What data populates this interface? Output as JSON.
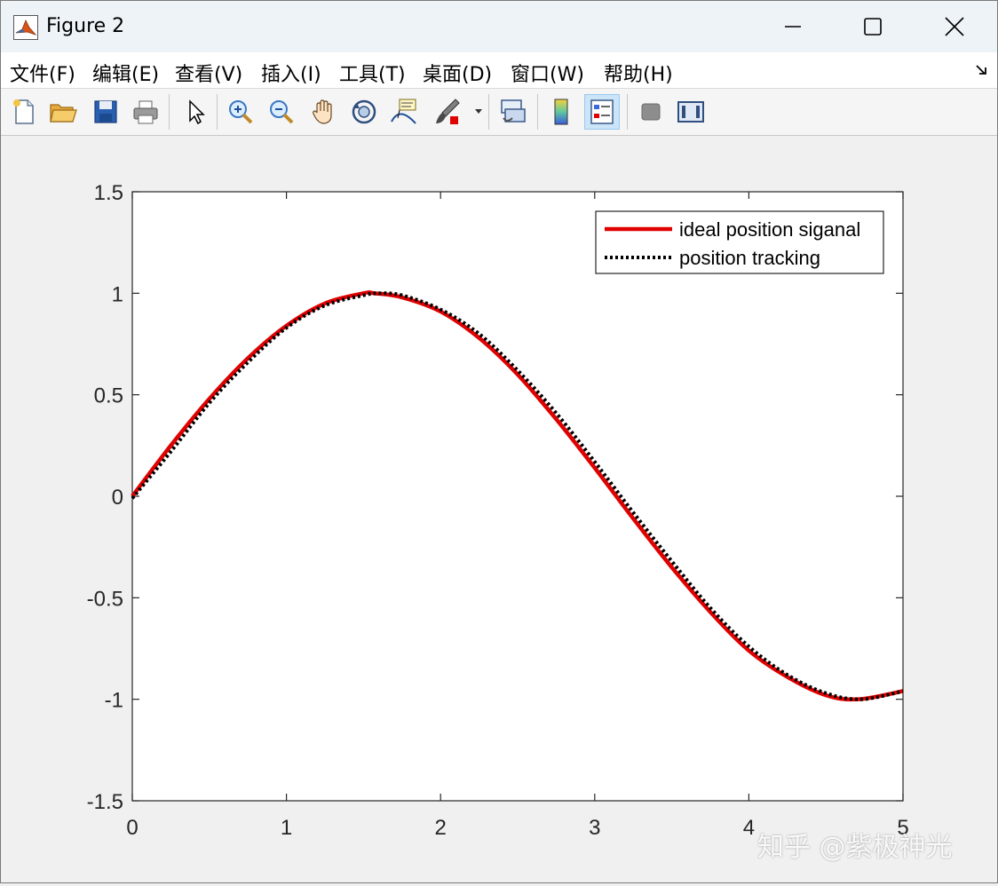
{
  "window": {
    "title": "Figure 2",
    "app_icon": "matlab-icon",
    "controls": [
      "minimize-icon",
      "maximize-icon",
      "close-icon"
    ]
  },
  "menubar": {
    "items": [
      {
        "label": "文件(F)"
      },
      {
        "label": "编辑(E)"
      },
      {
        "label": "查看(V)"
      },
      {
        "label": "插入(I)"
      },
      {
        "label": "工具(T)"
      },
      {
        "label": "桌面(D)"
      },
      {
        "label": "窗口(W)"
      },
      {
        "label": "帮助(H)"
      }
    ],
    "dock_icon": "dock-arrow-icon"
  },
  "toolbar": {
    "buttons": [
      {
        "icon": "new-figure-icon"
      },
      {
        "icon": "open-file-icon"
      },
      {
        "icon": "save-icon"
      },
      {
        "icon": "print-icon"
      },
      {
        "icon": "edit-plot-arrow-icon"
      },
      {
        "icon": "zoom-in-icon"
      },
      {
        "icon": "zoom-out-icon"
      },
      {
        "icon": "pan-hand-icon"
      },
      {
        "icon": "rotate-3d-icon"
      },
      {
        "icon": "data-cursor-icon"
      },
      {
        "icon": "brush-icon"
      },
      {
        "icon": "link-plot-icon"
      },
      {
        "icon": "insert-colorbar-icon"
      },
      {
        "icon": "insert-legend-icon",
        "active": true
      },
      {
        "icon": "hide-plot-tools-icon"
      },
      {
        "icon": "show-plot-tools-icon"
      }
    ]
  },
  "chart_data": {
    "type": "line",
    "title": "",
    "xlabel": "",
    "ylabel": "",
    "xlim": [
      0,
      5
    ],
    "ylim": [
      -1.5,
      1.5
    ],
    "xticks": [
      "0",
      "1",
      "2",
      "3",
      "4",
      "5"
    ],
    "yticks": [
      "1.5",
      "1",
      "0.5",
      "0",
      "-0.5",
      "-1",
      "-1.5"
    ],
    "grid": false,
    "legend_position": "top-right",
    "series": [
      {
        "name": "ideal position siganal",
        "color": "#e00000",
        "style": "solid",
        "x": [
          0,
          0.25,
          0.5,
          0.75,
          1.0,
          1.25,
          1.5,
          1.57,
          1.75,
          2.0,
          2.25,
          2.5,
          2.75,
          3.0,
          3.25,
          3.5,
          3.75,
          4.0,
          4.25,
          4.5,
          4.71,
          5.0
        ],
        "y": [
          0,
          0.25,
          0.48,
          0.68,
          0.84,
          0.95,
          1.0,
          1.0,
          0.98,
          0.91,
          0.78,
          0.6,
          0.38,
          0.14,
          -0.11,
          -0.35,
          -0.57,
          -0.76,
          -0.89,
          -0.98,
          -1.0,
          -0.96
        ]
      },
      {
        "name": "position tracking",
        "color": "#000000",
        "style": "dotted",
        "x": [
          0,
          0.25,
          0.5,
          0.75,
          1.0,
          1.25,
          1.5,
          1.6,
          1.75,
          2.0,
          2.25,
          2.5,
          2.75,
          3.0,
          3.25,
          3.5,
          3.75,
          4.0,
          4.25,
          4.5,
          4.73,
          5.0
        ],
        "y": [
          -0.01,
          0.22,
          0.46,
          0.66,
          0.83,
          0.94,
          0.99,
          1.0,
          0.99,
          0.92,
          0.8,
          0.62,
          0.41,
          0.17,
          -0.08,
          -0.32,
          -0.55,
          -0.74,
          -0.88,
          -0.97,
          -1.0,
          -0.96
        ]
      }
    ]
  },
  "watermark": "知乎 @紫极神光"
}
